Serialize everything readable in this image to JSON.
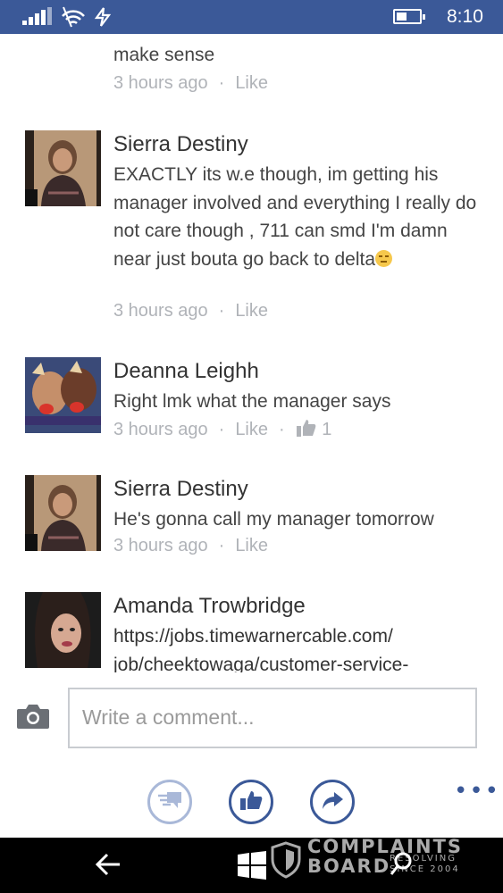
{
  "status_bar": {
    "time": "8:10",
    "battery_level": 0.45,
    "icons": [
      "signal-icon",
      "wifi-icon",
      "data-icon",
      "battery-icon"
    ]
  },
  "comments": [
    {
      "author": "",
      "text": "make sense",
      "timestamp": "3 hours ago",
      "like_label": "Like"
    },
    {
      "author": "Sierra Destiny",
      "text": "EXACTLY its w.e though, im getting his manager involved and everything I really do not care though , 711 can smd I'm damn near just bouta go back to delta",
      "emoji": "pensive-face-emoji",
      "timestamp": "3 hours ago",
      "like_label": "Like"
    },
    {
      "author": "Deanna Leighh",
      "text": "Right lmk what the manager says",
      "timestamp": "3 hours ago",
      "like_label": "Like",
      "like_count": "1"
    },
    {
      "author": "Sierra Destiny",
      "text": "He's gonna call my manager tomorrow",
      "timestamp": "3 hours ago",
      "like_label": "Like"
    },
    {
      "author": "Amanda Trowbridge",
      "text": "https://jobs.timewarnercable.com/ job/cheektowaga/customer-service-"
    }
  ],
  "composer": {
    "placeholder": "Write a comment..."
  },
  "actions": [
    "comments-icon",
    "like-icon",
    "share-icon",
    "more-icon"
  ],
  "more_label": "•••",
  "watermark": {
    "line1": "COMPLAINTS",
    "line2": "BOARD",
    "tag1": "RESOLVING",
    "tag2": "SINCE 2004"
  },
  "colors": {
    "brand": "#3b5998",
    "meta_text": "#b0b3b8"
  }
}
